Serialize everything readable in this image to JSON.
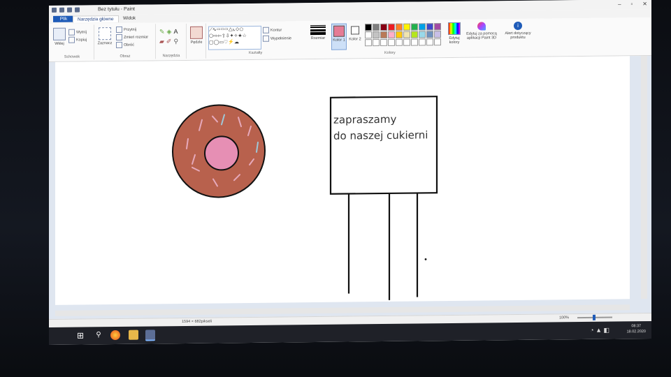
{
  "window": {
    "title": "Bez tytułu - Paint",
    "controls": {
      "minimize": "–",
      "maximize": "▫",
      "close": "✕"
    }
  },
  "tabs": [
    {
      "label": "Plik"
    },
    {
      "label": "Narzędzia główne"
    },
    {
      "label": "Widok"
    }
  ],
  "ribbon": {
    "clipboard": {
      "paste": "Wklej",
      "cut": "Wytnij",
      "copy": "Kopiuj",
      "group": "Schowek"
    },
    "image": {
      "select": "Zaznacz",
      "crop": "Przytnij",
      "resize": "Zmień rozmiar",
      "rotate": "Obróć",
      "group": "Obraz"
    },
    "tools": {
      "group": "Narzędzia"
    },
    "brushes": {
      "label": "Pędzle"
    },
    "shapes": {
      "outline": "Kontur",
      "fill": "Wypełnienie",
      "group": "Kształty"
    },
    "size": {
      "label": "Rozmiar"
    },
    "colors": {
      "color1": "Kolor 1",
      "color2": "Kolor 2",
      "edit": "Edytuj kolory",
      "paint3d": "Edytuj za pomocą aplikacji Paint 3D",
      "alert": "Alert dotyczący produktu",
      "group": "Kolory",
      "color1_value": "#e57b95",
      "palette_row1": [
        "#000000",
        "#7f7f7f",
        "#880015",
        "#ed1c24",
        "#ff7f27",
        "#fff200",
        "#22b14c",
        "#00a2e8",
        "#3f48cc",
        "#a349a4"
      ],
      "palette_row2": [
        "#ffffff",
        "#c3c3c3",
        "#b97a57",
        "#ffaec9",
        "#ffc90e",
        "#efe4b0",
        "#b5e61d",
        "#99d9ea",
        "#7092be",
        "#c8bfe7"
      ]
    }
  },
  "canvas": {
    "sign_text_line1": "zapraszamy",
    "sign_text_line2": "do naszej  cukierni",
    "donut_color": "#b8614d",
    "donut_hole_color": "#e68fb4"
  },
  "status": {
    "size": "1594 × 682pikseli",
    "zoom": "100%"
  },
  "taskbar": {
    "time": "08:37",
    "date": "18.02.2020"
  }
}
